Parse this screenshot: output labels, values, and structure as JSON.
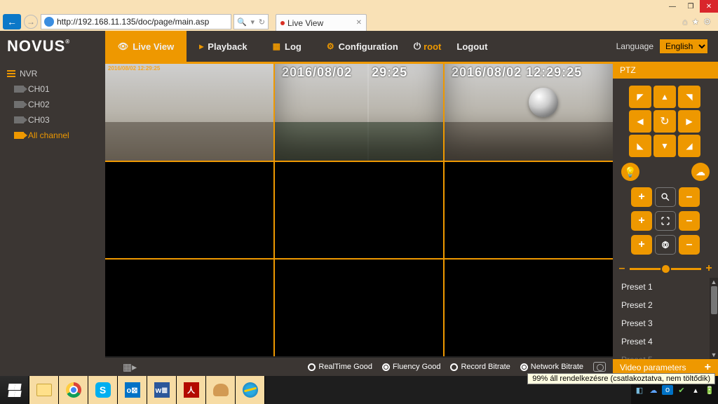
{
  "browser": {
    "url": "http://192.168.11.135/doc/page/main.asp",
    "tab_title": "Live View"
  },
  "nav": {
    "logo": "NOVUS",
    "live_view": "Live View",
    "playback": "Playback",
    "log": "Log",
    "configuration": "Configuration",
    "user": "root",
    "logout": "Logout",
    "language_label": "Language",
    "language_value": "English"
  },
  "sidebar": {
    "root": "NVR",
    "channels": [
      "CH01",
      "CH02",
      "CH03"
    ],
    "all_channel": "All channel"
  },
  "timestamps": {
    "c1": "2016/08/02 12:29:25",
    "c2a": "2016/08/02",
    "c2b": "29:25",
    "c3": "2016/08/02 12:29:25"
  },
  "vidbar": {
    "realtime": "RealTime Good",
    "fluency": "Fluency Good",
    "record": "Record Bitrate",
    "network": "Network Bitrate"
  },
  "ptz": {
    "title": "PTZ",
    "presets": [
      "Preset 1",
      "Preset 2",
      "Preset 3",
      "Preset 4",
      "Preset 5"
    ],
    "video_parameters": "Video parameters"
  },
  "tray": {
    "tooltip": "99% áll rendelkezésre (csatlakoztatva, nem töltődik)"
  }
}
